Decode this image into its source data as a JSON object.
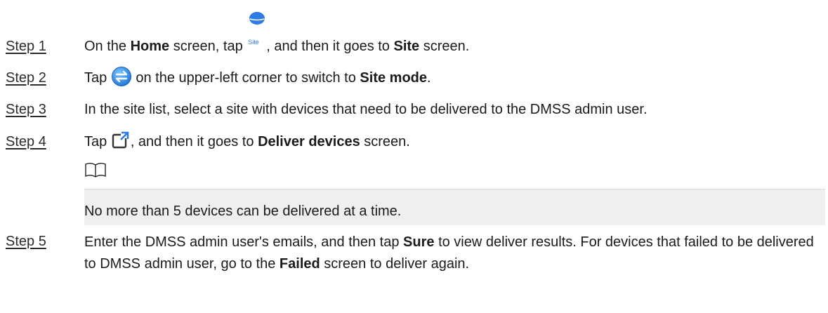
{
  "steps": [
    {
      "label": "Step 1",
      "parts": [
        "On the ",
        "Home",
        "  screen, tap ",
        ", and then it goes to ",
        "Site",
        " screen."
      ],
      "icon": "site-globe-icon",
      "icon_text": "Site"
    },
    {
      "label": "Step 2",
      "parts": [
        "Tap ",
        " on the upper-left corner to switch to ",
        "Site mode",
        "."
      ],
      "icon": "switch-arrows-icon"
    },
    {
      "label": "Step 3",
      "text": "In the site list, select a site with devices that need to be delivered to the DMSS admin user."
    },
    {
      "label": "Step 4",
      "parts": [
        "Tap ",
        ", and then it goes to ",
        "Deliver devices",
        "  screen."
      ],
      "icon": "deliver-export-icon"
    },
    {
      "label": "Step 5",
      "parts": [
        "Enter the DMSS admin user's emails, and then tap ",
        "Sure",
        "  to view deliver results. For devices that failed to be delivered to DMSS admin user, go to the ",
        "Failed",
        " screen to deliver again."
      ]
    }
  ],
  "note": {
    "icon": "book-note-icon",
    "text": "No more than 5 devices can be delivered at a time."
  },
  "colors": {
    "accent": "#2f7be6",
    "note_bg": "#efefef",
    "text": "#1a1a1a"
  }
}
